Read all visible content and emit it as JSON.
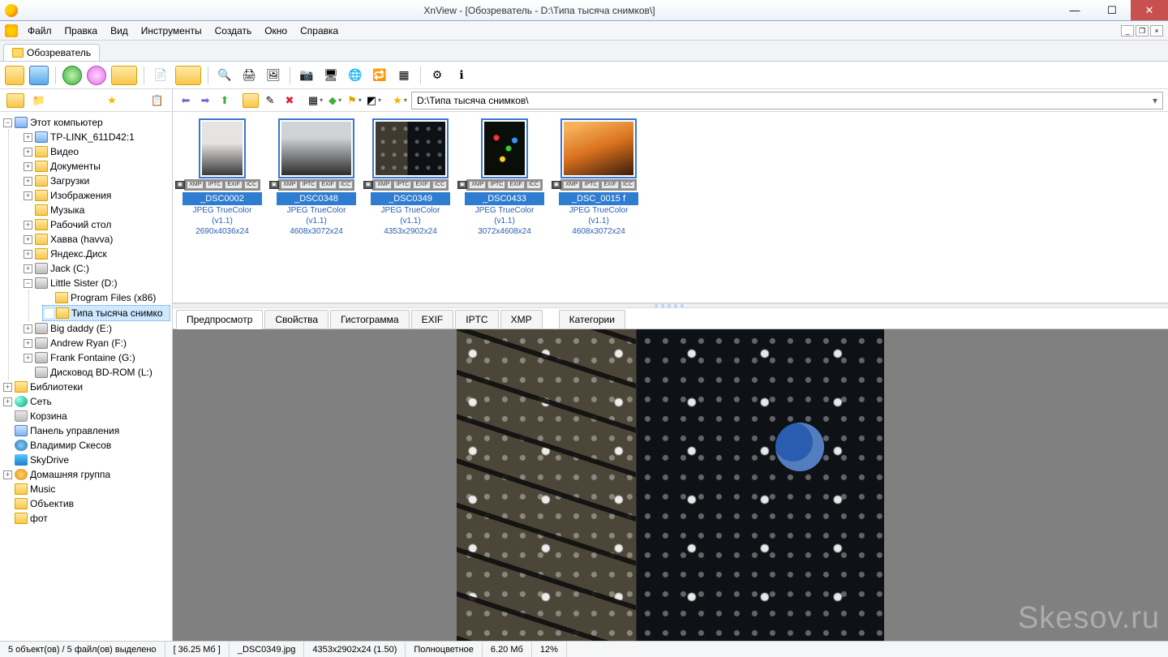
{
  "title": "XnView - [Обозреватель - D:\\Типа тысяча снимков\\]",
  "menus": [
    "Файл",
    "Правка",
    "Вид",
    "Инструменты",
    "Создать",
    "Окно",
    "Справка"
  ],
  "doc_tab": "Обозреватель",
  "path": "D:\\Типа тысяча снимков\\",
  "tree": {
    "root": "Этот компьютер",
    "items": [
      "TP-LINK_611D42:1",
      "Видео",
      "Документы",
      "Загрузки",
      "Изображения",
      "Музыка",
      "Рабочий стол",
      "Хавва (havva)",
      "Яндекс.Диск"
    ],
    "jack": "Jack (C:)",
    "little": "Little Sister (D:)",
    "little_children": [
      "Program Files (x86)",
      "Типа тысяча снимко"
    ],
    "drives": [
      "Big daddy (E:)",
      "Andrew Ryan (F:)",
      "Frank Fontaine (G:)",
      "Дисковод BD-ROM (L:)"
    ],
    "lib": "Библиотеки",
    "net": "Сеть",
    "bin": "Корзина",
    "cp": "Панель управления",
    "usr": "Владимир Скесов",
    "sky": "SkyDrive",
    "home": "Домашняя группа",
    "extra": [
      "Music",
      "Объектив",
      "фот"
    ]
  },
  "thumbs": [
    {
      "name": "_DSC0002",
      "meta1": "JPEG TrueColor (v1.1)",
      "meta2": "2690x4036x24",
      "portrait": true,
      "cls": "t0"
    },
    {
      "name": "_DSC0348",
      "meta1": "JPEG TrueColor (v1.1)",
      "meta2": "4608x3072x24",
      "portrait": false,
      "cls": "t1"
    },
    {
      "name": "_DSC0349",
      "meta1": "JPEG TrueColor (v1.1)",
      "meta2": "4353x2902x24",
      "portrait": false,
      "cls": "t2"
    },
    {
      "name": "_DSC0433",
      "meta1": "JPEG TrueColor (v1.1)",
      "meta2": "3072x4608x24",
      "portrait": true,
      "cls": "t3"
    },
    {
      "name": "_DSC_0015 f",
      "meta1": "JPEG TrueColor (v1.1)",
      "meta2": "4608x3072x24",
      "portrait": false,
      "cls": "t4"
    }
  ],
  "badges": [
    "XMP",
    "IPTC",
    "EXIF",
    "ICC"
  ],
  "ptabs": [
    "Предпросмотр",
    "Свойства",
    "Гистограмма",
    "EXIF",
    "IPTC",
    "XMP",
    "Категории"
  ],
  "ptabs_gap_after": 5,
  "status": {
    "sel": "5 объект(ов) / 5 файл(ов) выделено",
    "total": "[ 36.25 Мб ]",
    "file": "_DSC0349.jpg",
    "dims": "4353x2902x24 (1.50)",
    "color": "Полноцветное",
    "size": "6.20 Мб",
    "zoom": "12%"
  },
  "watermark": "Skesov.ru"
}
